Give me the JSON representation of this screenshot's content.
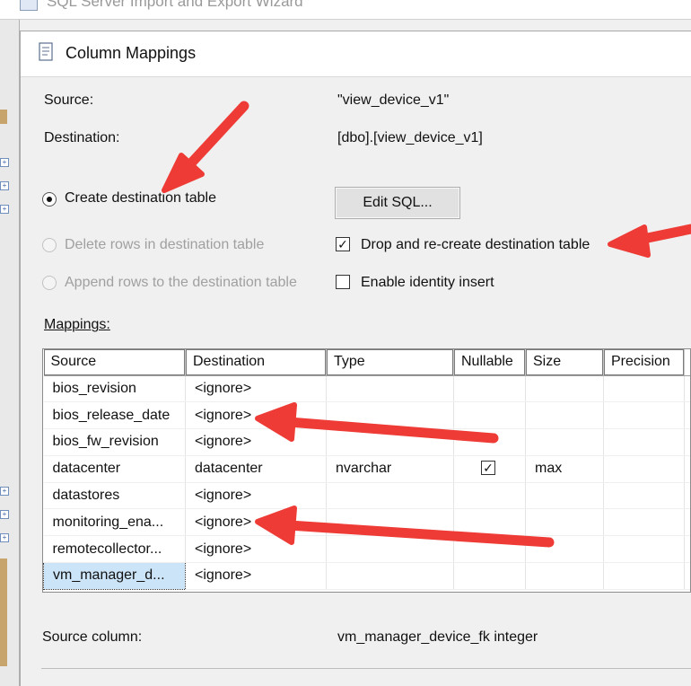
{
  "window": {
    "outer_title": "SQL Server Import and Export Wizard",
    "dialog_title": "Column Mappings"
  },
  "info": {
    "source_label": "Source:",
    "source_value": "\"view_device_v1\"",
    "destination_label": "Destination:",
    "destination_value": "[dbo].[view_device_v1]"
  },
  "options": {
    "create_table": {
      "label": "Create destination table",
      "selected": true,
      "enabled": true
    },
    "delete_rows": {
      "label": "Delete rows in destination table",
      "selected": false,
      "enabled": false
    },
    "append_rows": {
      "label": "Append rows to the destination table",
      "selected": false,
      "enabled": false
    },
    "edit_sql_label": "Edit SQL...",
    "drop_recreate": {
      "label": "Drop and re-create destination table",
      "checked": true
    },
    "identity_insert": {
      "label": "Enable identity insert",
      "checked": false
    }
  },
  "mappings": {
    "label": "Mappings:",
    "columns": [
      "Source",
      "Destination",
      "Type",
      "Nullable",
      "Size",
      "Precision"
    ],
    "rows": [
      {
        "source": "bios_revision",
        "destination": "<ignore>",
        "type": "",
        "nullable": false,
        "size": "",
        "precision": ""
      },
      {
        "source": "bios_release_date",
        "destination": "<ignore>",
        "type": "",
        "nullable": false,
        "size": "",
        "precision": ""
      },
      {
        "source": "bios_fw_revision",
        "destination": "<ignore>",
        "type": "",
        "nullable": false,
        "size": "",
        "precision": ""
      },
      {
        "source": "datacenter",
        "destination": "datacenter",
        "type": "nvarchar",
        "nullable": true,
        "size": "max",
        "precision": ""
      },
      {
        "source": "datastores",
        "destination": "<ignore>",
        "type": "",
        "nullable": false,
        "size": "",
        "precision": ""
      },
      {
        "source": "monitoring_ena...",
        "destination": "<ignore>",
        "type": "",
        "nullable": false,
        "size": "",
        "precision": ""
      },
      {
        "source": "remotecollector...",
        "destination": "<ignore>",
        "type": "",
        "nullable": false,
        "size": "",
        "precision": ""
      },
      {
        "source": "vm_manager_d...",
        "destination": "<ignore>",
        "type": "",
        "nullable": false,
        "size": "",
        "precision": "",
        "selected": true
      }
    ]
  },
  "footer": {
    "source_column_label": "Source column:",
    "source_column_value": "vm_manager_device_fk integer"
  },
  "colors": {
    "annotation_arrow": "#ee3b35",
    "selected_cell": "#cce4f7"
  }
}
